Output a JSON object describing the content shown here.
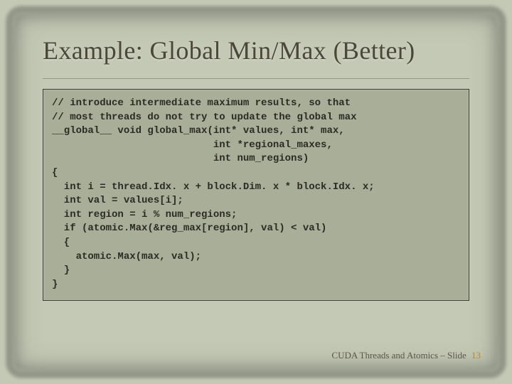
{
  "title": "Example: Global Min/Max (Better)",
  "code": "// introduce intermediate maximum results, so that\n// most threads do not try to update the global max\n__global__ void global_max(int* values, int* max,\n                           int *regional_maxes,\n                           int num_regions)\n{\n  int i = thread.Idx. x + block.Dim. x * block.Idx. x;\n  int val = values[i];\n  int region = i % num_regions;\n  if (atomic.Max(&reg_max[region], val) < val)\n  {\n    atomic.Max(max, val);\n  }\n}",
  "footer_text": "CUDA Threads and Atomics – Slide",
  "footer_num": "13"
}
